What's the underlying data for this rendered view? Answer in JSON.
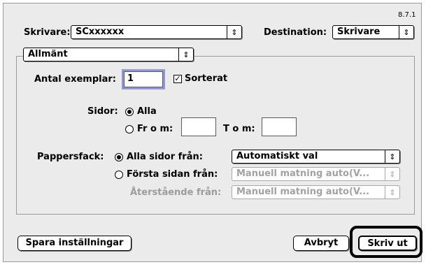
{
  "version": "8.7.1",
  "printer": {
    "label": "Skrivare:",
    "value": "SCxxxxxx"
  },
  "destination": {
    "label": "Destination:",
    "value": "Skrivare"
  },
  "panel": {
    "value": "Allmänt"
  },
  "copies": {
    "label": "Antal exemplar:",
    "value": "1",
    "collate_label": "Sorterat",
    "collate_checked": true
  },
  "pages": {
    "label": "Sidor:",
    "all_label": "Alla",
    "from_label": "Fr o m:",
    "from_value": "",
    "to_label": "T o m:",
    "to_value": ""
  },
  "paper": {
    "label": "Pappersfack:",
    "all_pages_label": "Alla sidor från:",
    "all_pages_value": "Automatiskt val",
    "first_page_label": "Första sidan från:",
    "first_page_value": "Manuell matning auto(V...",
    "remaining_label": "Återstående från:",
    "remaining_value": "Manuell matning auto(V..."
  },
  "buttons": {
    "save": "Spara inställningar",
    "cancel": "Avbryt",
    "print": "Skriv ut"
  },
  "icons": {
    "popup_arrow": "⇕",
    "check": "✓"
  }
}
